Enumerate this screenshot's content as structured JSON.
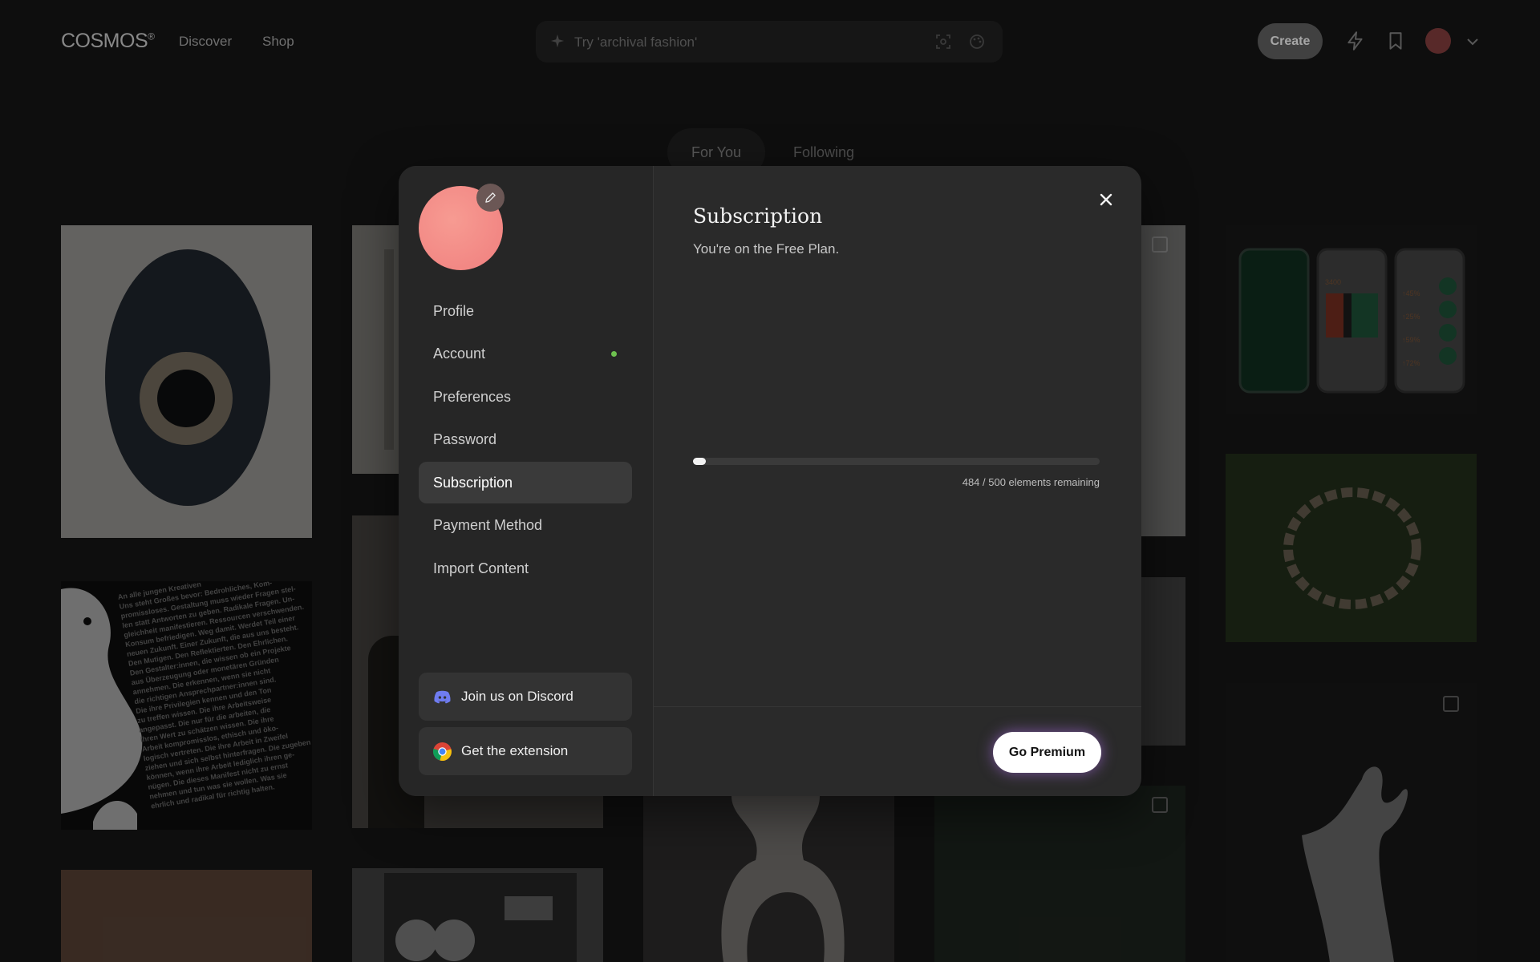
{
  "header": {
    "logo": "COSMOS",
    "logo_mark": "®",
    "nav": [
      "Discover",
      "Shop"
    ],
    "search_placeholder": "Try 'archival fashion'",
    "create_label": "Create"
  },
  "feed_tabs": [
    "For You",
    "Following"
  ],
  "modal": {
    "menu": [
      {
        "label": "Profile",
        "active": false
      },
      {
        "label": "Account",
        "active": false,
        "indicator": true
      },
      {
        "label": "Preferences",
        "active": false
      },
      {
        "label": "Password",
        "active": false
      },
      {
        "label": "Subscription",
        "active": true
      },
      {
        "label": "Payment Method",
        "active": false
      },
      {
        "label": "Import Content",
        "active": false
      }
    ],
    "discord_label": "Join us on Discord",
    "extension_label": "Get the extension",
    "title": "Subscription",
    "subtitle": "You're on the Free Plan.",
    "usage": {
      "used_fraction": 0.032,
      "text": "484 / 500 elements remaining"
    },
    "premium_label": "Go Premium"
  },
  "background": {
    "poster_text": "An alle jungen Kreativen\nUns steht Großes bevor: Bedrohliches, Kom-\npromissloses. Gestaltung muss wieder Fragen stel-\nlen statt Antworten zu geben. Radikale Fragen. Un-\ngleichheit manifestieren. Ressourcen verschwenden.\nKonsum befriedigen. Weg damit. Werdet Teil einer\nneuen Zukunft. Einer Zukunft, die aus uns besteht.\nDen Mutigen. Den Reflektierten. Den Ehrlichen.\nDen Gestalter:innen, die wissen ob ein Projekte\naus Überzeugung oder monetären Gründen\nannehmen. Die erkennen, wenn sie nicht\ndie richtigen Ansprechpartner:innen sind.\nDie ihre Privilegien kennen und den Ton\nzu treffen wissen. Die ihre Arbeitsweise\nangepasst. Die nur für die arbeiten, die\nihren Wert zu schätzen wissen. Die ihre\nArbeit kompromisslos, ethisch und öko-\nlogisch vertreten. Die ihre Arbeit in Zweifel\nziehen und sich selbst hinterfragen. Die zugeben\nkönnen, wenn ihre Arbeit lediglich ihren ge-\nnügen. Die dieses Manifest nicht zu ernst\nnehmen und tun was sie wollen. Was sie\nehrlich und radikal für richtig halten.",
    "phone_values": [
      "3400",
      "↑45%",
      "↑25%",
      "↑59%",
      "↑72%"
    ]
  },
  "colors": {
    "accent_avatar": "#f38a86",
    "status_dot": "#6ec14f",
    "premium_glow": "#be78ff"
  }
}
